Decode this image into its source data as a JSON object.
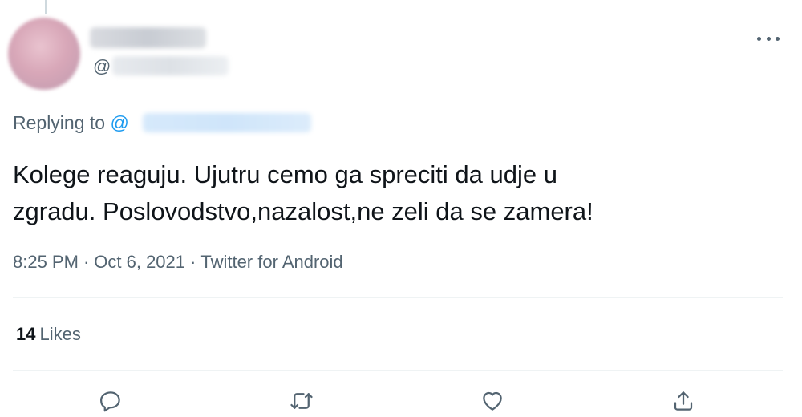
{
  "author": {
    "handle_prefix": "@"
  },
  "reply": {
    "label": "Replying to",
    "mention_prefix": "@"
  },
  "tweet": {
    "text": "Kolege reaguju. Ujutru cemo ga spreciti da udje u\nzgradu. Poslovodstvo,nazalost,ne zeli da se zamera!",
    "time": "8:25 PM",
    "date": "Oct 6, 2021",
    "source": "Twitter for Android",
    "separator": "·"
  },
  "stats": {
    "likes_count": "14",
    "likes_label": "Likes"
  },
  "actions": [
    {
      "icon": "reply-icon"
    },
    {
      "icon": "retweet-icon"
    },
    {
      "icon": "like-icon"
    },
    {
      "icon": "share-icon"
    }
  ],
  "colors": {
    "text": "#0f1419",
    "secondary": "#536471",
    "accent": "#1d9bf0",
    "divider": "#eff3f4"
  }
}
